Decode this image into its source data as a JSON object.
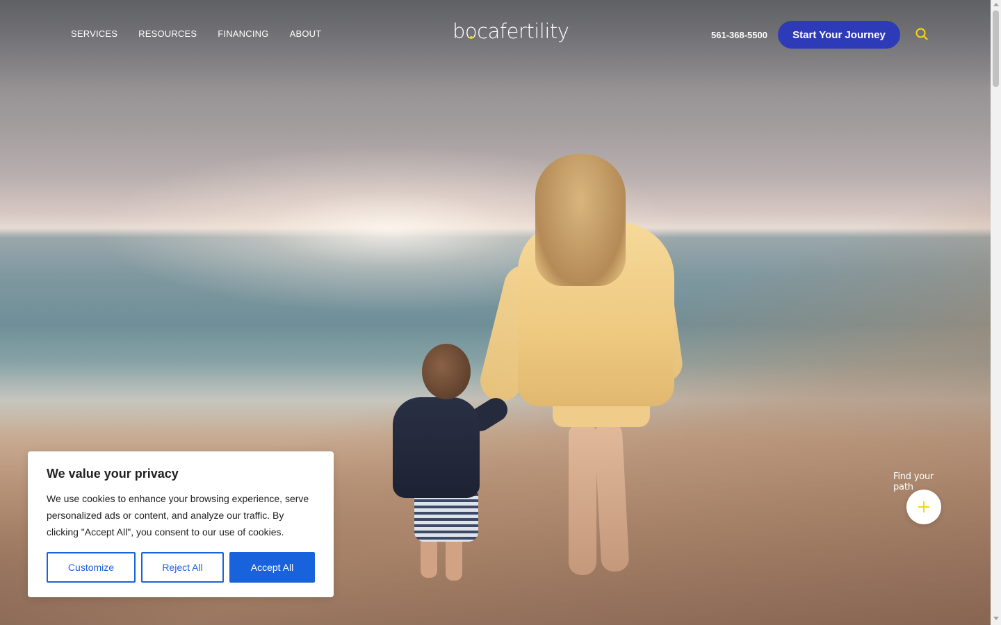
{
  "header": {
    "nav": [
      {
        "label": "SERVICES"
      },
      {
        "label": "RESOURCES"
      },
      {
        "label": "FINANCING"
      },
      {
        "label": "ABOUT"
      }
    ],
    "logo_text": "bocafertility",
    "phone": "561-368-5500",
    "cta_label": "Start Your Journey",
    "search_icon": "search-icon"
  },
  "hero": {
    "find_path_label": "Find your path",
    "find_path_icon": "plus-icon"
  },
  "cookie_banner": {
    "title": "We value your privacy",
    "body": "We use cookies to enhance your browsing experience, serve personalized ads or content, and analyze our traffic. By clicking \"Accept All\", you consent to our use of cookies.",
    "customize_label": "Customize",
    "reject_label": "Reject All",
    "accept_label": "Accept All"
  },
  "colors": {
    "cta_bg": "#2e3bb8",
    "accent_yellow": "#f5d90a",
    "cookie_blue": "#1863dc"
  }
}
